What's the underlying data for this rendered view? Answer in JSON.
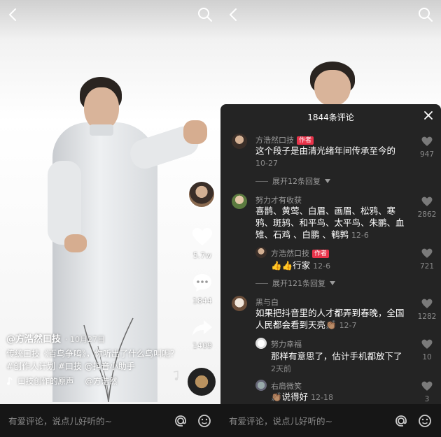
{
  "left": {
    "author": "@方浩然口技",
    "date": "· 10月27日",
    "caption": "传统口技《百鸟争鸣》，你听出了什么鸟叫呢？#创作人计划 #口技 @抖音小助手",
    "music": "口技创作的原声",
    "music_author": "@方浩然",
    "likes": "5.7w",
    "comments": "1844",
    "shares": "1409"
  },
  "comment_bar": {
    "placeholder": "有爱评论，说点儿好听的~"
  },
  "sheet": {
    "title": "1844条评论",
    "comments": [
      {
        "name": "方浩然口技",
        "tag": "作者",
        "text": "这个段子是由清光绪年间传承至今的",
        "time": "10-27",
        "likes": "947",
        "replies": "展开12条回复"
      },
      {
        "name": "努力才有收获",
        "text": "喜鹊、黄莺、白眉、画眉、松鸦、寒鸦、斑鸫、和平鸟、太平鸟、朱鹂、血雉、石鸡 、白鹏 、鹌鹑",
        "time": "12-6",
        "likes": "2862"
      },
      {
        "name": "方浩然口技",
        "tag": "作者",
        "text": "👍👍行家",
        "time": "12-6",
        "likes": "721",
        "replies": "展开121条回复"
      },
      {
        "name": "黑与白",
        "text": "如果把抖音里的人才都弄到春晚，全国人民都会看到天亮👏🏽",
        "time": "12-7",
        "likes": "1282"
      },
      {
        "name": "努力幸福",
        "text": "那样有意思了，估计手机都放下了",
        "time": "2天前",
        "likes": "10"
      },
      {
        "name": "右肩微笑",
        "text": "👏🏽说得好",
        "time": "12-18",
        "likes": "3"
      }
    ]
  },
  "icons": [
    "back-arrow-icon",
    "search-icon",
    "heart-icon",
    "comment-icon",
    "share-icon",
    "music-note-icon",
    "at-icon",
    "emoji-icon",
    "close-icon"
  ]
}
